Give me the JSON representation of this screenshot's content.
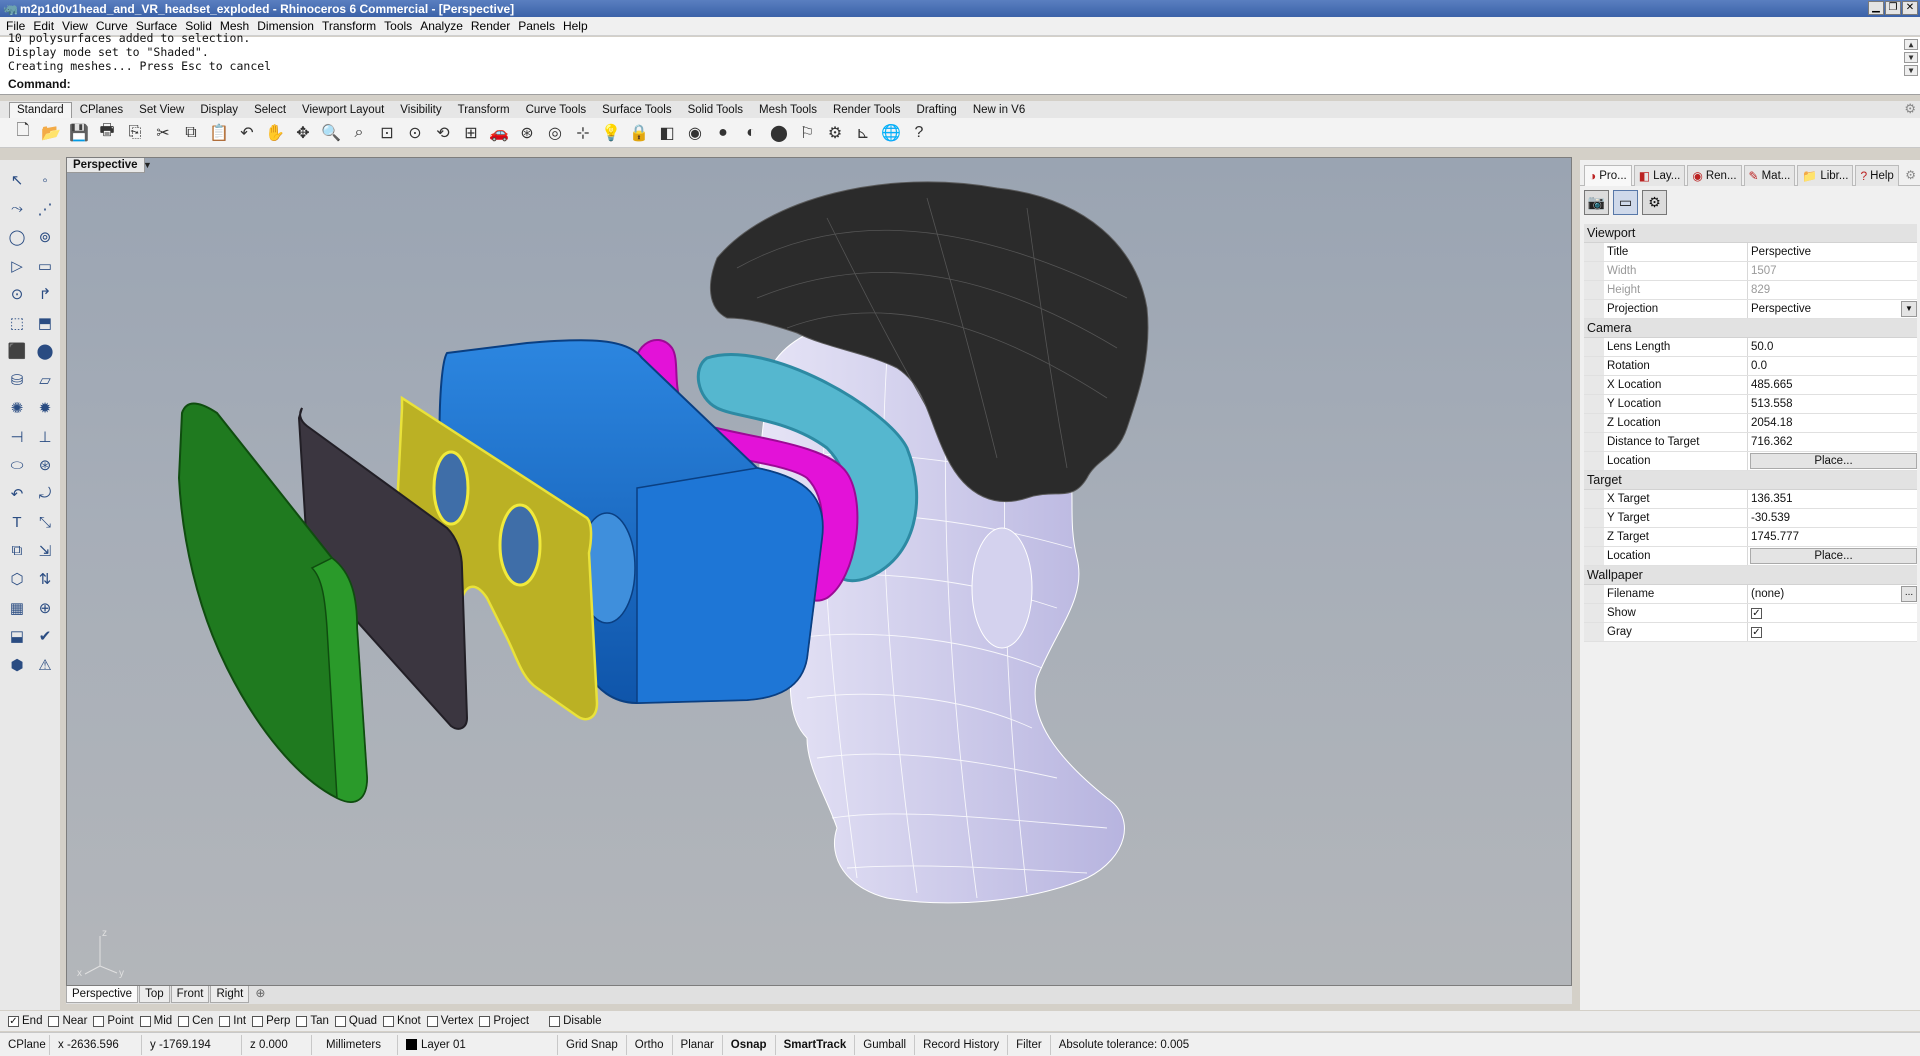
{
  "window": {
    "title": "m2p1d0v1head_and_VR_headset_exploded - Rhinoceros 6 Commercial - [Perspective]",
    "controls": [
      "▁",
      "❐",
      "✕"
    ]
  },
  "menu": [
    "File",
    "Edit",
    "View",
    "Curve",
    "Surface",
    "Solid",
    "Mesh",
    "Dimension",
    "Transform",
    "Tools",
    "Analyze",
    "Render",
    "Panels",
    "Help"
  ],
  "command_history": [
    "10 polysurfaces added to selection.",
    "Display mode set to \"Shaded\".",
    "Creating meshes... Press Esc to cancel"
  ],
  "command_prompt": "Command:",
  "toolbar_tabs": [
    "Standard",
    "CPlanes",
    "Set View",
    "Display",
    "Select",
    "Viewport Layout",
    "Visibility",
    "Transform",
    "Curve Tools",
    "Surface Tools",
    "Solid Tools",
    "Mesh Tools",
    "Render Tools",
    "Drafting",
    "New in V6"
  ],
  "active_toolbar_tab": "Standard",
  "standard_tools": [
    {
      "name": "new-file-icon",
      "glyph": "🗋"
    },
    {
      "name": "open-file-icon",
      "glyph": "📂"
    },
    {
      "name": "save-icon",
      "glyph": "💾"
    },
    {
      "name": "print-icon",
      "glyph": "🖶"
    },
    {
      "name": "import-icon",
      "glyph": "⎘"
    },
    {
      "name": "cut-icon",
      "glyph": "✂"
    },
    {
      "name": "copy-icon",
      "glyph": "⧉"
    },
    {
      "name": "paste-icon",
      "glyph": "📋"
    },
    {
      "name": "undo-icon",
      "glyph": "↶"
    },
    {
      "name": "pan-hand-icon",
      "glyph": "✋"
    },
    {
      "name": "rotate-view-icon",
      "glyph": "✥"
    },
    {
      "name": "zoom-icon",
      "glyph": "🔍"
    },
    {
      "name": "zoom-window-icon",
      "glyph": "⌕"
    },
    {
      "name": "zoom-extents-icon",
      "glyph": "⊡"
    },
    {
      "name": "zoom-selected-icon",
      "glyph": "⊙"
    },
    {
      "name": "undo-view-icon",
      "glyph": "⟲"
    },
    {
      "name": "viewport-layout-icon",
      "glyph": "⊞"
    },
    {
      "name": "car-icon",
      "glyph": "🚗"
    },
    {
      "name": "camera-icon",
      "glyph": "⊛"
    },
    {
      "name": "target-icon",
      "glyph": "◎"
    },
    {
      "name": "snap-icon",
      "glyph": "⊹"
    },
    {
      "name": "light-bulb-icon",
      "glyph": "💡"
    },
    {
      "name": "lock-icon",
      "glyph": "🔒"
    },
    {
      "name": "layer-icon",
      "glyph": "◧"
    },
    {
      "name": "color-wheel-icon",
      "glyph": "◉"
    },
    {
      "name": "shaded-sphere-icon",
      "glyph": "●"
    },
    {
      "name": "rendered-sphere-icon",
      "glyph": "◐"
    },
    {
      "name": "render-sphere-icon",
      "glyph": "⬤"
    },
    {
      "name": "cursor-flag-icon",
      "glyph": "⚐"
    },
    {
      "name": "options-gear-icon",
      "glyph": "⚙"
    },
    {
      "name": "dimension-icon",
      "glyph": "⊾"
    },
    {
      "name": "globe-icon",
      "glyph": "🌐"
    },
    {
      "name": "help-icon",
      "glyph": "?"
    }
  ],
  "left_tools": [
    [
      "↖",
      "◦"
    ],
    [
      "⤳",
      "⋰"
    ],
    [
      "◯",
      "⊚"
    ],
    [
      "▷",
      "▭"
    ],
    [
      "⊙",
      "↱"
    ],
    [
      "⬚",
      "⬒"
    ],
    [
      "⬛",
      "⬤"
    ],
    [
      "⛁",
      "▱"
    ],
    [
      "✺",
      "✹"
    ],
    [
      "⊣",
      "⊥"
    ],
    [
      "⬭",
      "⊛"
    ],
    [
      "↶",
      "⤾"
    ],
    [
      "T",
      "⤡"
    ],
    [
      "⧉",
      "⇲"
    ],
    [
      "⬡",
      "⇅"
    ],
    [
      "▦",
      "⊕"
    ],
    [
      "⬓",
      "✔"
    ],
    [
      "⬢",
      "⚠"
    ]
  ],
  "viewport": {
    "label": "Perspective",
    "axis": {
      "x": "x",
      "y": "y",
      "z": "z"
    }
  },
  "viewport_tabs": [
    "Perspective",
    "Top",
    "Front",
    "Right"
  ],
  "active_viewport_tab": "Perspective",
  "panel_tabs": [
    {
      "label": "Pro...",
      "icon": "properties-icon",
      "glyph": "◑"
    },
    {
      "label": "Lay...",
      "icon": "layers-icon",
      "glyph": "◧"
    },
    {
      "label": "Ren...",
      "icon": "render-icon",
      "glyph": "◉"
    },
    {
      "label": "Mat...",
      "icon": "materials-icon",
      "glyph": "✎"
    },
    {
      "label": "Libr...",
      "icon": "libraries-icon",
      "glyph": "📁"
    },
    {
      "label": "Help",
      "icon": "help-icon",
      "glyph": "?"
    }
  ],
  "properties": {
    "viewport_title": "Viewport",
    "viewport": [
      {
        "key": "Title",
        "value": "Perspective",
        "disabled": false
      },
      {
        "key": "Width",
        "value": "1507",
        "disabled": true
      },
      {
        "key": "Height",
        "value": "829",
        "disabled": true
      },
      {
        "key": "Projection",
        "value": "Perspective",
        "disabled": false,
        "dropdown": true
      }
    ],
    "camera_title": "Camera",
    "camera": [
      {
        "key": "Lens Length",
        "value": "50.0"
      },
      {
        "key": "Rotation",
        "value": "0.0"
      },
      {
        "key": "X Location",
        "value": "485.665"
      },
      {
        "key": "Y Location",
        "value": "513.558"
      },
      {
        "key": "Z Location",
        "value": "2054.18"
      },
      {
        "key": "Distance to Target",
        "value": "716.362"
      },
      {
        "key": "Location",
        "value": "Place...",
        "button": true
      }
    ],
    "target_title": "Target",
    "target": [
      {
        "key": "X Target",
        "value": "136.351"
      },
      {
        "key": "Y Target",
        "value": "-30.539"
      },
      {
        "key": "Z Target",
        "value": "1745.777"
      },
      {
        "key": "Location",
        "value": "Place...",
        "button": true
      }
    ],
    "wallpaper_title": "Wallpaper",
    "wallpaper": {
      "filename_label": "Filename",
      "filename_value": "(none)",
      "show_label": "Show",
      "show_checked": true,
      "gray_label": "Gray",
      "gray_checked": true
    }
  },
  "osnaps": [
    {
      "label": "End",
      "checked": true
    },
    {
      "label": "Near",
      "checked": false
    },
    {
      "label": "Point",
      "checked": false
    },
    {
      "label": "Mid",
      "checked": false
    },
    {
      "label": "Cen",
      "checked": false
    },
    {
      "label": "Int",
      "checked": false
    },
    {
      "label": "Perp",
      "checked": false
    },
    {
      "label": "Tan",
      "checked": false
    },
    {
      "label": "Quad",
      "checked": false
    },
    {
      "label": "Knot",
      "checked": false
    },
    {
      "label": "Vertex",
      "checked": false
    },
    {
      "label": "Project",
      "checked": false
    },
    {
      "label": "Disable",
      "checked": false
    }
  ],
  "status": {
    "cplane": "CPlane",
    "x": "x -2636.596",
    "y": "y -1769.194",
    "z": "z 0.000",
    "units": "Millimeters",
    "layer": "Layer 01",
    "grid_snap": "Grid Snap",
    "ortho": "Ortho",
    "planar": "Planar",
    "osnap": "Osnap",
    "smarttrack": "SmartTrack",
    "gumball": "Gumball",
    "record_history": "Record History",
    "filter": "Filter",
    "tolerance": "Absolute tolerance: 0.005"
  },
  "colors": {
    "viewport_bg": "#a4acb8",
    "hair": "#2b2b2b",
    "head": "#c9c7ea",
    "green_panel": "#1f7a1f",
    "dark_panel": "#3b3640",
    "yellow_panel": "#b9b021",
    "blue_body": "#1665c8",
    "magenta_strap": "#e312d8",
    "cyan_gasket": "#50b4cc"
  }
}
